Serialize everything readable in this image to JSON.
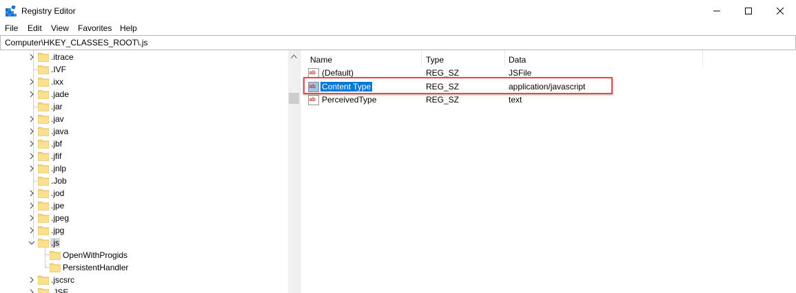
{
  "window": {
    "title": "Registry Editor",
    "app_icon": "registry-editor-icon",
    "controls": {
      "minimize": "minimize-icon",
      "maximize": "maximize-icon",
      "close": "close-icon"
    }
  },
  "menu": [
    "File",
    "Edit",
    "View",
    "Favorites",
    "Help"
  ],
  "address": "Computer\\HKEY_CLASSES_ROOT\\.js",
  "tree": {
    "items": [
      {
        "label": ".itrace",
        "expander": "collapsed",
        "level": 0
      },
      {
        "label": ".IVF",
        "expander": "none",
        "level": 0
      },
      {
        "label": ".ixx",
        "expander": "collapsed",
        "level": 0
      },
      {
        "label": ".jade",
        "expander": "collapsed",
        "level": 0
      },
      {
        "label": ".jar",
        "expander": "none",
        "level": 0
      },
      {
        "label": ".jav",
        "expander": "collapsed",
        "level": 0
      },
      {
        "label": ".java",
        "expander": "collapsed",
        "level": 0
      },
      {
        "label": ".jbf",
        "expander": "collapsed",
        "level": 0
      },
      {
        "label": ".jfif",
        "expander": "collapsed",
        "level": 0
      },
      {
        "label": ".jnlp",
        "expander": "collapsed",
        "level": 0
      },
      {
        "label": ".Job",
        "expander": "none",
        "level": 0
      },
      {
        "label": ".jod",
        "expander": "collapsed",
        "level": 0
      },
      {
        "label": ".jpe",
        "expander": "collapsed",
        "level": 0
      },
      {
        "label": ".jpeg",
        "expander": "collapsed",
        "level": 0
      },
      {
        "label": ".jpg",
        "expander": "collapsed",
        "level": 0
      },
      {
        "label": ".js",
        "expander": "expanded",
        "level": 0,
        "selected": true
      },
      {
        "label": "OpenWithProgids",
        "expander": "none",
        "level": 1
      },
      {
        "label": "PersistentHandler",
        "expander": "none",
        "level": 1
      },
      {
        "label": ".jscsrc",
        "expander": "collapsed",
        "level": 0
      },
      {
        "label": ".JSE",
        "expander": "collapsed",
        "level": 0
      }
    ]
  },
  "list": {
    "columns": [
      "Name",
      "Type",
      "Data"
    ],
    "rows": [
      {
        "name": "(Default)",
        "type": "REG_SZ",
        "data": "JSFile",
        "selected": false
      },
      {
        "name": "Content Type",
        "type": "REG_SZ",
        "data": "application/javascript",
        "selected": true
      },
      {
        "name": "PerceivedType",
        "type": "REG_SZ",
        "data": "text",
        "selected": false
      }
    ]
  },
  "colors": {
    "selection": "#0078d7",
    "highlight_box": "#e8474b",
    "folder": "#f8d775"
  }
}
